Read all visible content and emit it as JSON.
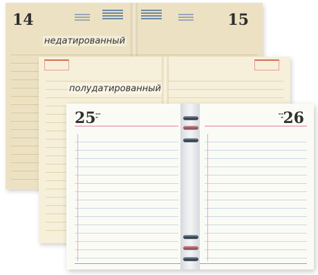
{
  "planners": {
    "undated": {
      "caption": "недатированный",
      "left_number": "14",
      "right_number": "15"
    },
    "half_dated": {
      "caption": "полудатированный"
    },
    "dated": {
      "left_number": "25",
      "right_number": "26"
    }
  },
  "colors": {
    "undated_paper": "#ece2c3",
    "half_dated_paper": "#f6efd9",
    "dated_paper": "#fbfbf6",
    "accent_red": "#e07e9a",
    "ruling_blue": "#c9d7e6",
    "ring_dark": "#2d3b47"
  }
}
